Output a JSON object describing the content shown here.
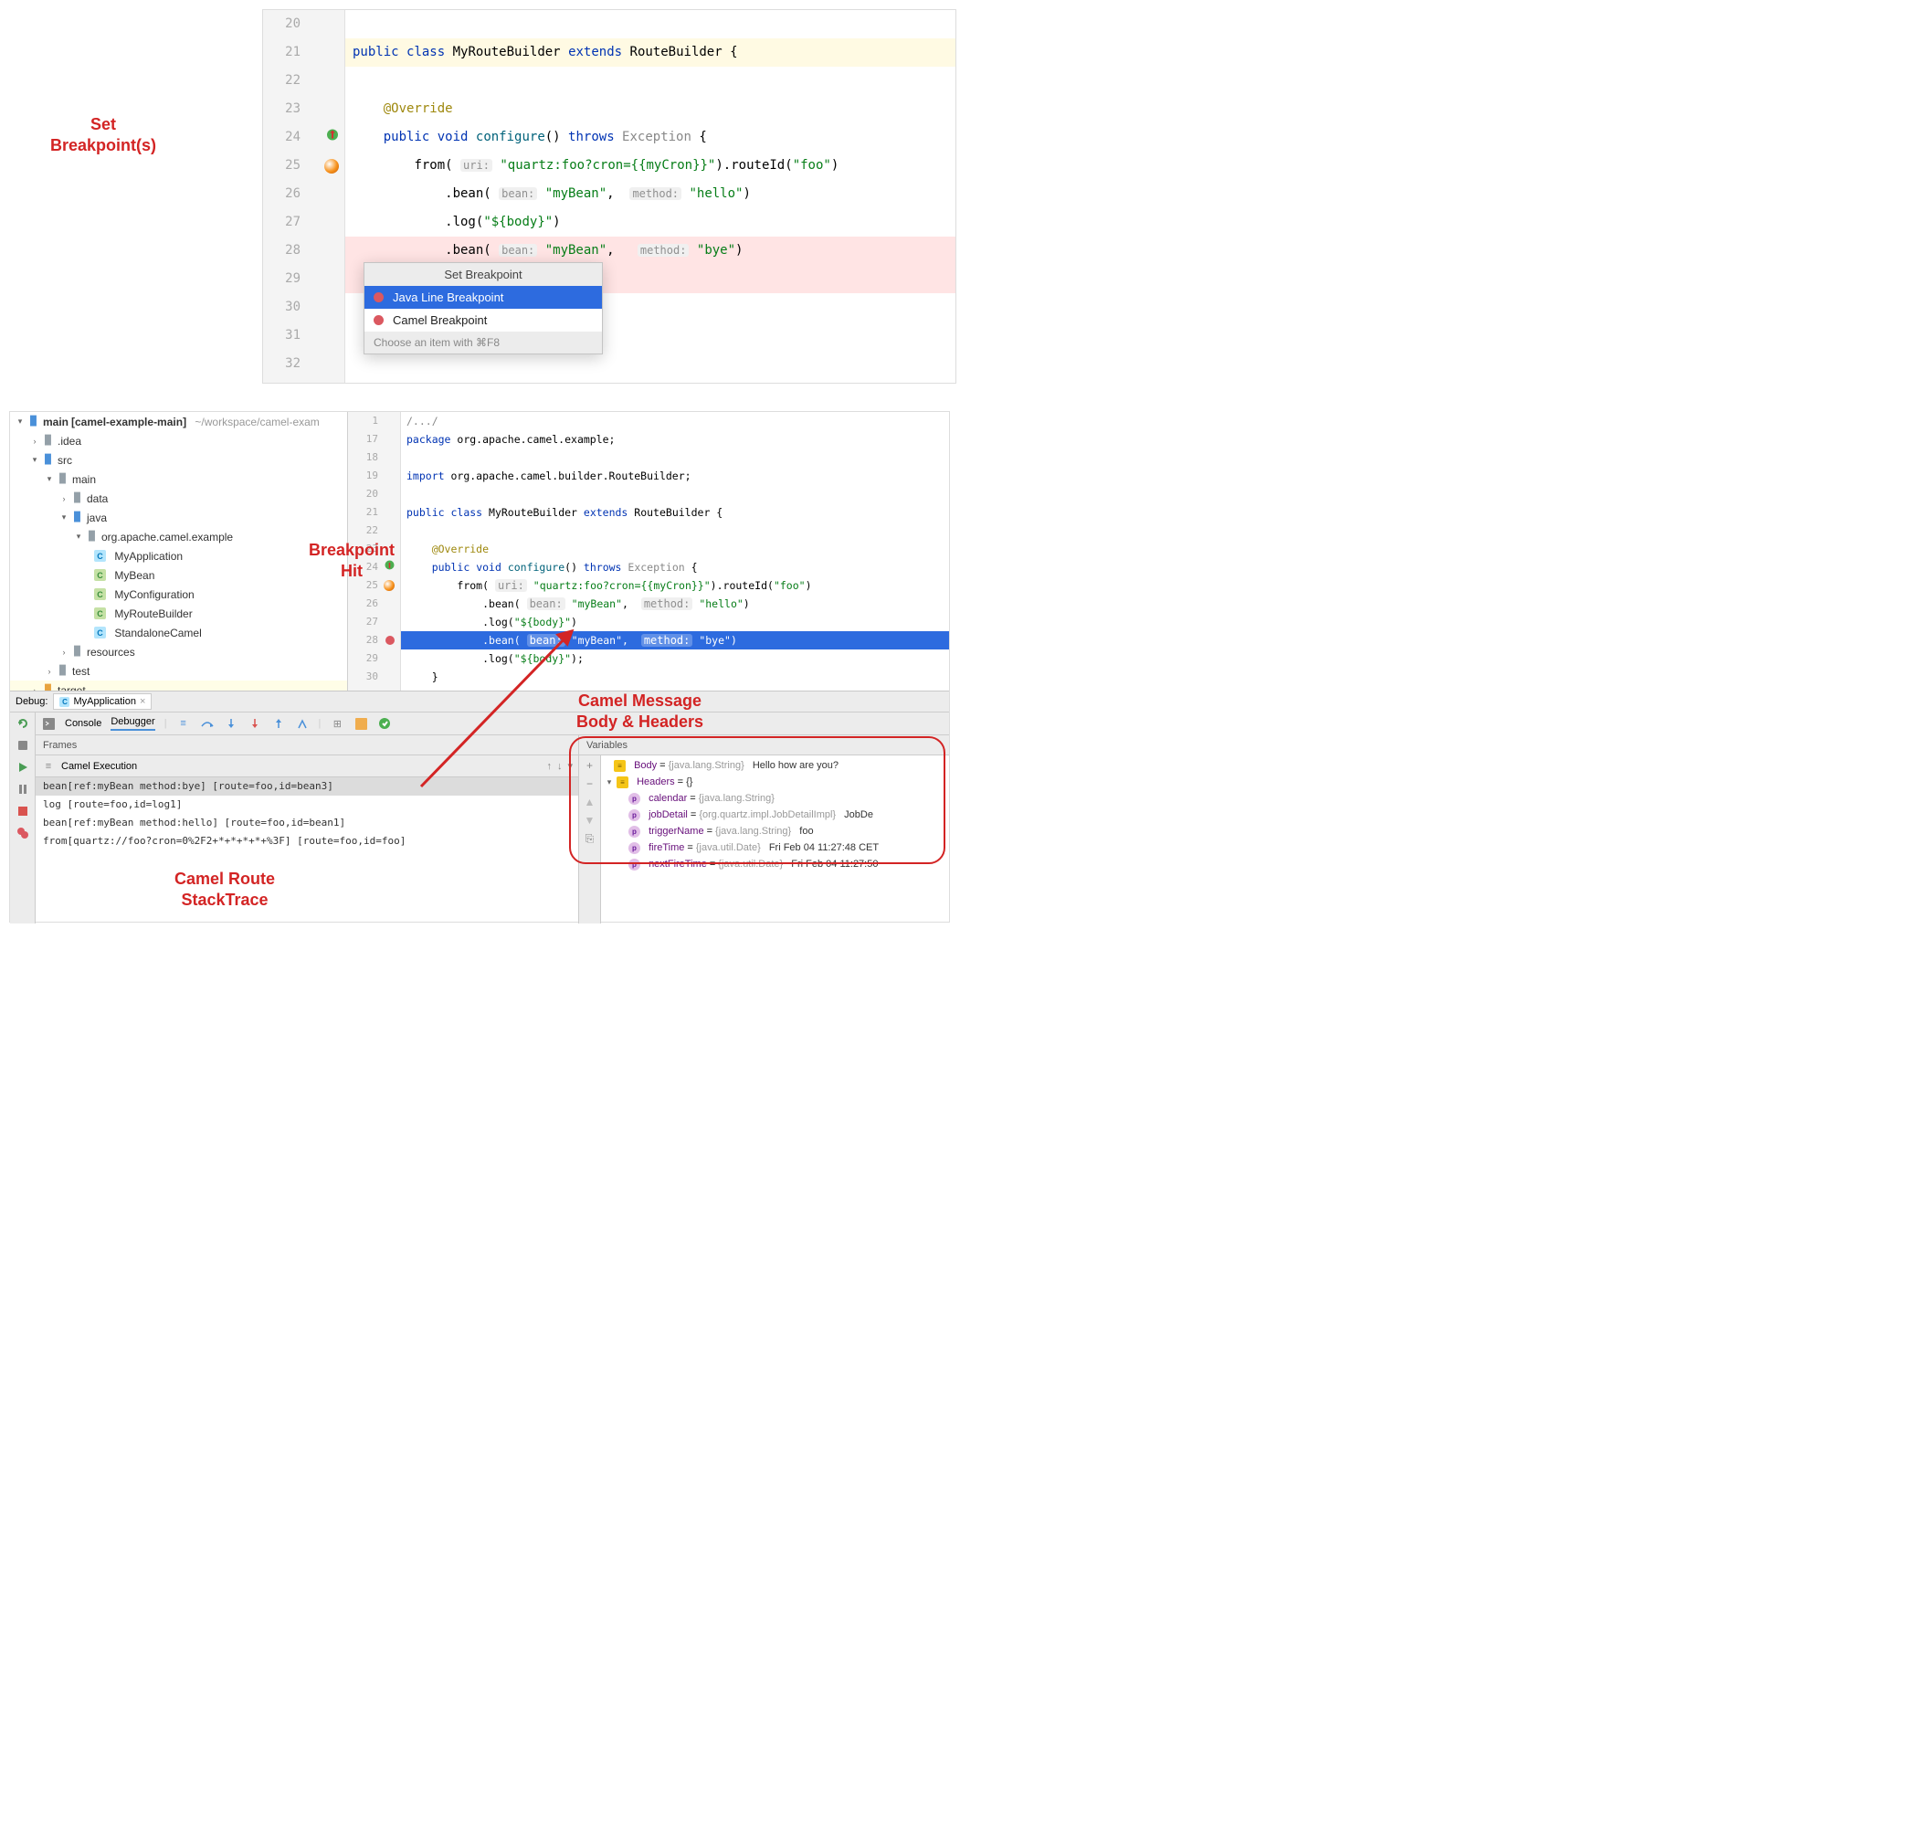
{
  "annotations": {
    "set_bp": "Set\nBreakpoint(s)",
    "bp_hit": "Breakpoint\nHit",
    "msg": "Camel Message\nBody & Headers",
    "stack": "Camel Route\nStackTrace"
  },
  "editor1": {
    "lines": [
      {
        "n": 20,
        "code": ""
      },
      {
        "n": 21,
        "kw1": "public",
        "kw2": "class",
        "cls": "MyRouteBuilder",
        "kw3": "extends",
        "sup": "RouteBuilder",
        "end": " {",
        "yel": true
      },
      {
        "n": 22,
        "code": ""
      },
      {
        "n": 23,
        "indent": "    ",
        "anno": "@Override"
      },
      {
        "n": 24,
        "indent": "    ",
        "kw1": "public",
        "kw2": "void",
        "fn": "configure",
        "txt": "() ",
        "kw3": "throws",
        "ex": " Exception ",
        " end": "{",
        "gic": "green"
      },
      {
        "n": 25,
        "indent": "        ",
        "fn": "from",
        "h1": "uri:",
        "s1": "\"quartz:foo?cron={{myCron}}\"",
        "mid": ").",
        "fn2": "routeId",
        "s2": "\"foo\"",
        "end": ")",
        "gic": "camel"
      },
      {
        "n": 26,
        "indent": "            .",
        "fn": "bean",
        "h1": "bean:",
        "s1": "\"myBean\"",
        "sep": ",  ",
        "h2": "method:",
        "s2": "\"hello\"",
        "end": ")"
      },
      {
        "n": 27,
        "indent": "            .",
        "fn": "log",
        "s1": "\"${body}\"",
        "end": ")"
      },
      {
        "n": 28,
        "indent": "            .",
        "fn": "bean",
        "h1": "bean:",
        "s1": "\"myBean\"",
        "sep": ",   ",
        "h2": "method:",
        "s2": "\"bye\"",
        "end": ")",
        "pink": true
      },
      {
        "n": 29,
        "code": "                              );",
        "pink": true
      },
      {
        "n": 30,
        "code": ""
      },
      {
        "n": 31,
        "code": ""
      },
      {
        "n": 32,
        "code": ""
      }
    ]
  },
  "popup": {
    "title": "Set Breakpoint",
    "items": [
      "Java Line Breakpoint",
      "Camel Breakpoint"
    ],
    "footer": "Choose an item with ⌘F8"
  },
  "project": {
    "root_main": "main",
    "root_proj": "[camel-example-main]",
    "root_path": "~/workspace/camel-exam",
    "idea": ".idea",
    "src": "src",
    "main2": "main",
    "data": "data",
    "java": "java",
    "pkg": "org.apache.camel.example",
    "files": [
      "MyApplication",
      "MyBean",
      "MyConfiguration",
      "MyRouteBuilder",
      "StandaloneCamel"
    ],
    "icons": [
      "c",
      "c",
      "c",
      "c",
      "c"
    ],
    "resources": "resources",
    "test": "test",
    "target": "target"
  },
  "editor2": {
    "lines": [
      {
        "n": 1,
        "fold": "/.../"
      },
      {
        "n": 17,
        "kw": "package",
        "txt": " org.apache.camel.example;"
      },
      {
        "n": 18,
        "txt": ""
      },
      {
        "n": 19,
        "kw": "import",
        "txt": " org.apache.camel.builder.RouteBuilder;"
      },
      {
        "n": 20,
        "txt": ""
      },
      {
        "n": 21,
        "kw1": "public",
        "kw2": "class",
        "cls": " MyRouteBuilder ",
        "kw3": "extends",
        "sup": " RouteBuilder ",
        "end": "{"
      },
      {
        "n": 22,
        "txt": ""
      },
      {
        "n": 23,
        "indent": "    ",
        "anno": "@Override"
      },
      {
        "n": 24,
        "indent": "    ",
        "kw1": "public",
        "kw2": "void",
        "fn": " configure",
        "txt": "() ",
        "kw3": "throws",
        "ex": " Exception ",
        "end": "{",
        "gic": "green"
      },
      {
        "n": 25,
        "indent": "        ",
        "fn": "from",
        "h1": "uri:",
        "s1": "\"quartz:foo?cron={{myCron}}\"",
        "mid": ").",
        "fn2": "routeId",
        "s2": "\"foo\"",
        "end": ")",
        "gic": "camel"
      },
      {
        "n": 26,
        "indent": "            .",
        "fn": "bean",
        "h1": "bean:",
        "s1": "\"myBean\"",
        "sep": ",  ",
        "h2": "method:",
        "s2": "\"hello\"",
        "end": ")"
      },
      {
        "n": 27,
        "indent": "            .",
        "fn": "log",
        "s1": "\"${body}\"",
        "end": ")"
      },
      {
        "n": 28,
        "indent": "            .",
        "fn": "bean",
        "h1": "bean:",
        "s1": "\"myBean\"",
        "sep": ",  ",
        "h2": "method:",
        "s2": "\"bye\"",
        "end": ")",
        "cur": true,
        "gic": "bp"
      },
      {
        "n": 29,
        "indent": "            .",
        "fn": "log",
        "s1": "\"${body}\"",
        "end": ");"
      },
      {
        "n": 30,
        "txt": "    }"
      }
    ]
  },
  "debug": {
    "label": "Debug:",
    "tab": "MyApplication",
    "console": "Console",
    "debugger": "Debugger",
    "frames": "Frames",
    "exec": "Camel Execution",
    "stack": [
      "bean[ref:myBean method:bye] [route=foo,id=bean3]",
      "log [route=foo,id=log1]",
      "bean[ref:myBean method:hello] [route=foo,id=bean1]",
      "from[quartz://foo?cron=0%2F2+*+*+*+*+%3F] [route=foo,id=foo]"
    ],
    "vars_title": "Variables",
    "vars": {
      "body_name": "Body",
      "body_type": "{java.lang.String}",
      "body_val": "Hello how are you?",
      "headers_name": "Headers",
      "headers_val": "{}",
      "rows": [
        {
          "name": "calendar",
          "type": "{java.lang.String}",
          "val": ""
        },
        {
          "name": "jobDetail",
          "type": "{org.quartz.impl.JobDetailImpl}",
          "val": "JobDe"
        },
        {
          "name": "triggerName",
          "type": "{java.lang.String}",
          "val": "foo"
        },
        {
          "name": "fireTime",
          "type": "{java.util.Date}",
          "val": "Fri Feb 04 11:27:48 CET"
        },
        {
          "name": "nextFireTime",
          "type": "{java.util.Date}",
          "val": "Fri Feb 04 11:27:50"
        }
      ]
    }
  }
}
